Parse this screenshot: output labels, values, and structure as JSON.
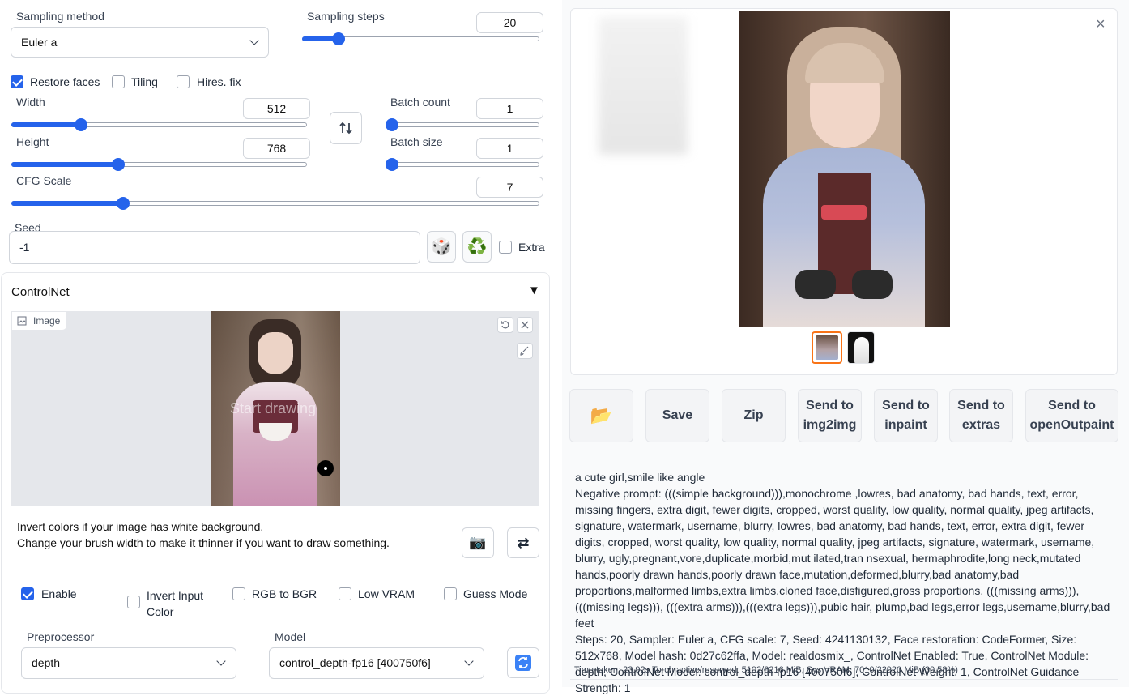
{
  "sampling": {
    "method_label": "Sampling method",
    "method_value": "Euler a",
    "steps_label": "Sampling steps",
    "steps_value": "20",
    "steps_frac": 0.15
  },
  "options": {
    "restore_faces": "Restore faces",
    "tiling": "Tiling",
    "hires_fix": "Hires. fix"
  },
  "dims": {
    "width_label": "Width",
    "width_value": "512",
    "width_frac": 0.235,
    "height_label": "Height",
    "height_value": "768",
    "height_frac": 0.36,
    "batch_count_label": "Batch count",
    "batch_count_value": "1",
    "batch_count_frac": 0.0,
    "batch_size_label": "Batch size",
    "batch_size_value": "1",
    "batch_size_frac": 0.0,
    "cfg_label": "CFG Scale",
    "cfg_value": "7",
    "cfg_frac": 0.21
  },
  "seed": {
    "label": "Seed",
    "value": "-1",
    "extra": "Extra",
    "dice": "🎲",
    "recycle": "♻️"
  },
  "controlnet": {
    "title": "ControlNet",
    "collapse": "▼",
    "image_tab": "Image",
    "canvas_text": "Start drawing",
    "hint1": "Invert colors if your image has white background.",
    "hint2": "Change your brush width to make it thinner if you want to draw something.",
    "enable": "Enable",
    "invert": "Invert Input Color",
    "rgb": "RGB to BGR",
    "lowvram": "Low VRAM",
    "guess": "Guess Mode",
    "preprocessor_label": "Preprocessor",
    "preprocessor_value": "depth",
    "model_label": "Model",
    "model_value": "control_depth-fp16 [400750f6]",
    "camera": "📷",
    "swap": "⇄"
  },
  "output": {
    "buttons": {
      "folder": "📂",
      "save": "Save",
      "zip": "Zip",
      "img2img": "Send to img2img",
      "inpaint": "Send to inpaint",
      "extras": "Send to extras",
      "outpaint": "Send to openOutpaint"
    },
    "close": "×",
    "prompt": "a cute girl,smile like angle",
    "negative": "Negative prompt: (((simple background))),monochrome ,lowres, bad anatomy, bad hands, text, error, missing fingers, extra digit, fewer digits, cropped, worst quality, low quality, normal quality, jpeg artifacts, signature, watermark, username, blurry, lowres, bad anatomy, bad hands, text, error, extra digit, fewer digits, cropped, worst quality, low quality, normal quality, jpeg artifacts, signature, watermark, username, blurry, ugly,pregnant,vore,duplicate,morbid,mut ilated,tran nsexual, hermaphrodite,long neck,mutated hands,poorly drawn hands,poorly drawn face,mutation,deformed,blurry,bad anatomy,bad proportions,malformed limbs,extra limbs,cloned face,disfigured,gross proportions, (((missing arms))),(((missing legs))), (((extra arms))),(((extra legs))),pubic hair, plump,bad legs,error legs,username,blurry,bad feet",
    "params": "Steps: 20, Sampler: Euler a, CFG scale: 7, Seed: 4241130132, Face restoration: CodeFormer, Size: 512x768, Model hash: 0d27c62ffa, Model: realdosmix_, ControlNet Enabled: True, ControlNet Module: depth, ControlNet Model: control_depth-fp16 [400750f6], ControlNet Weight: 1, ControlNet Guidance Strength: 1",
    "time": "Time taken: 23.92s  Torch active/reserved: 5102/6216 MiB, Sys VRAM: 7010/22920 MiB (30.58%)"
  },
  "colors": {
    "accent": "#2563eb",
    "panel": "#f9fafb",
    "thumb_selected": "#f97316"
  }
}
